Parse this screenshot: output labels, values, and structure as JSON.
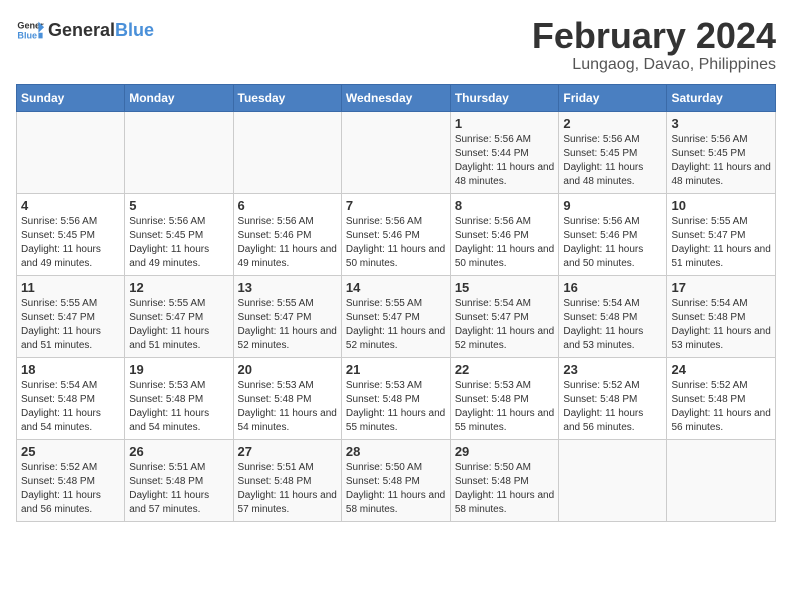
{
  "header": {
    "logo_general": "General",
    "logo_blue": "Blue",
    "title": "February 2024",
    "subtitle": "Lungaog, Davao, Philippines"
  },
  "weekdays": [
    "Sunday",
    "Monday",
    "Tuesday",
    "Wednesday",
    "Thursday",
    "Friday",
    "Saturday"
  ],
  "weeks": [
    [
      {
        "day": "",
        "info": ""
      },
      {
        "day": "",
        "info": ""
      },
      {
        "day": "",
        "info": ""
      },
      {
        "day": "",
        "info": ""
      },
      {
        "day": "1",
        "info": "Sunrise: 5:56 AM\nSunset: 5:44 PM\nDaylight: 11 hours\nand 48 minutes."
      },
      {
        "day": "2",
        "info": "Sunrise: 5:56 AM\nSunset: 5:45 PM\nDaylight: 11 hours\nand 48 minutes."
      },
      {
        "day": "3",
        "info": "Sunrise: 5:56 AM\nSunset: 5:45 PM\nDaylight: 11 hours\nand 48 minutes."
      }
    ],
    [
      {
        "day": "4",
        "info": "Sunrise: 5:56 AM\nSunset: 5:45 PM\nDaylight: 11 hours\nand 49 minutes."
      },
      {
        "day": "5",
        "info": "Sunrise: 5:56 AM\nSunset: 5:45 PM\nDaylight: 11 hours\nand 49 minutes."
      },
      {
        "day": "6",
        "info": "Sunrise: 5:56 AM\nSunset: 5:46 PM\nDaylight: 11 hours\nand 49 minutes."
      },
      {
        "day": "7",
        "info": "Sunrise: 5:56 AM\nSunset: 5:46 PM\nDaylight: 11 hours\nand 50 minutes."
      },
      {
        "day": "8",
        "info": "Sunrise: 5:56 AM\nSunset: 5:46 PM\nDaylight: 11 hours\nand 50 minutes."
      },
      {
        "day": "9",
        "info": "Sunrise: 5:56 AM\nSunset: 5:46 PM\nDaylight: 11 hours\nand 50 minutes."
      },
      {
        "day": "10",
        "info": "Sunrise: 5:55 AM\nSunset: 5:47 PM\nDaylight: 11 hours\nand 51 minutes."
      }
    ],
    [
      {
        "day": "11",
        "info": "Sunrise: 5:55 AM\nSunset: 5:47 PM\nDaylight: 11 hours\nand 51 minutes."
      },
      {
        "day": "12",
        "info": "Sunrise: 5:55 AM\nSunset: 5:47 PM\nDaylight: 11 hours\nand 51 minutes."
      },
      {
        "day": "13",
        "info": "Sunrise: 5:55 AM\nSunset: 5:47 PM\nDaylight: 11 hours\nand 52 minutes."
      },
      {
        "day": "14",
        "info": "Sunrise: 5:55 AM\nSunset: 5:47 PM\nDaylight: 11 hours\nand 52 minutes."
      },
      {
        "day": "15",
        "info": "Sunrise: 5:54 AM\nSunset: 5:47 PM\nDaylight: 11 hours\nand 52 minutes."
      },
      {
        "day": "16",
        "info": "Sunrise: 5:54 AM\nSunset: 5:48 PM\nDaylight: 11 hours\nand 53 minutes."
      },
      {
        "day": "17",
        "info": "Sunrise: 5:54 AM\nSunset: 5:48 PM\nDaylight: 11 hours\nand 53 minutes."
      }
    ],
    [
      {
        "day": "18",
        "info": "Sunrise: 5:54 AM\nSunset: 5:48 PM\nDaylight: 11 hours\nand 54 minutes."
      },
      {
        "day": "19",
        "info": "Sunrise: 5:53 AM\nSunset: 5:48 PM\nDaylight: 11 hours\nand 54 minutes."
      },
      {
        "day": "20",
        "info": "Sunrise: 5:53 AM\nSunset: 5:48 PM\nDaylight: 11 hours\nand 54 minutes."
      },
      {
        "day": "21",
        "info": "Sunrise: 5:53 AM\nSunset: 5:48 PM\nDaylight: 11 hours\nand 55 minutes."
      },
      {
        "day": "22",
        "info": "Sunrise: 5:53 AM\nSunset: 5:48 PM\nDaylight: 11 hours\nand 55 minutes."
      },
      {
        "day": "23",
        "info": "Sunrise: 5:52 AM\nSunset: 5:48 PM\nDaylight: 11 hours\nand 56 minutes."
      },
      {
        "day": "24",
        "info": "Sunrise: 5:52 AM\nSunset: 5:48 PM\nDaylight: 11 hours\nand 56 minutes."
      }
    ],
    [
      {
        "day": "25",
        "info": "Sunrise: 5:52 AM\nSunset: 5:48 PM\nDaylight: 11 hours\nand 56 minutes."
      },
      {
        "day": "26",
        "info": "Sunrise: 5:51 AM\nSunset: 5:48 PM\nDaylight: 11 hours\nand 57 minutes."
      },
      {
        "day": "27",
        "info": "Sunrise: 5:51 AM\nSunset: 5:48 PM\nDaylight: 11 hours\nand 57 minutes."
      },
      {
        "day": "28",
        "info": "Sunrise: 5:50 AM\nSunset: 5:48 PM\nDaylight: 11 hours\nand 58 minutes."
      },
      {
        "day": "29",
        "info": "Sunrise: 5:50 AM\nSunset: 5:48 PM\nDaylight: 11 hours\nand 58 minutes."
      },
      {
        "day": "",
        "info": ""
      },
      {
        "day": "",
        "info": ""
      }
    ]
  ]
}
